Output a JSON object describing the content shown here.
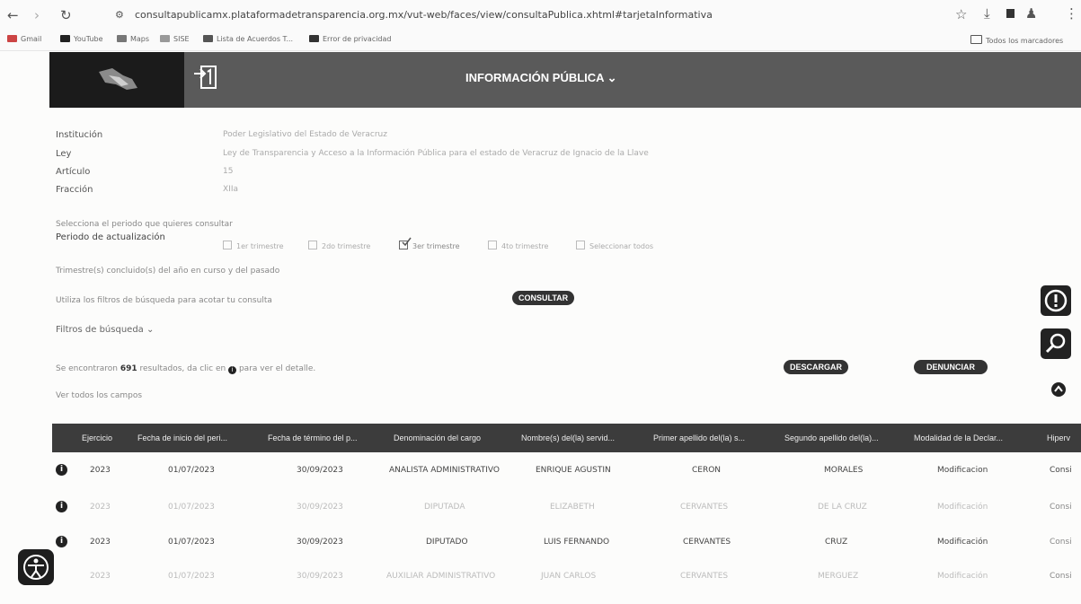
{
  "browser": {
    "url": "consultapublicamx.plataformadetransparencia.org.mx/vut-web/faces/view/consultaPublica.xhtml#tarjetaInformativa",
    "bookmarks": [
      "Gmail",
      "YouTube",
      "Maps",
      "SISE",
      "Lista de Acuerdos T...",
      "Error de privacidad"
    ],
    "all_bookmarks": "Todos los marcadores"
  },
  "header": {
    "title": "INFORMACIÓN PÚBLICA ⌄"
  },
  "info": {
    "institucion_label": "Institución",
    "institucion_value": "Poder Legislativo del Estado de Veracruz",
    "ley_label": "Ley",
    "ley_value": "Ley de Transparencia y Acceso a la Información Pública para el estado de Veracruz de Ignacio de la Llave",
    "articulo_label": "Artículo",
    "articulo_value": "15",
    "fraccion_label": "Fracción",
    "fraccion_value": "XIIa"
  },
  "periodo": {
    "prompt": "Selecciona el periodo que quieres consultar",
    "label": "Periodo de actualización",
    "quarters": [
      "1er trimestre",
      "2do trimestre",
      "3er trimestre",
      "4to trimestre",
      "Seleccionar todos"
    ]
  },
  "concluded_note": "Trimestre(s) concluido(s) del año en curso y del pasado",
  "filter_hint": "Utiliza los filtros de búsqueda para acotar tu consulta",
  "consultar_label": "CONSULTAR",
  "filtros_label": "Filtros de búsqueda ⌄",
  "results": {
    "prefix": "Se encontraron",
    "count": "691",
    "suffix": "resultados, da clic en",
    "suffix2": "para ver el detalle."
  },
  "descargar_label": "DESCARGAR",
  "denunciar_label": "DENUNCIAR",
  "ver_campos": "Ver todos los campos",
  "table": {
    "headers": [
      "Ejercicio",
      "Fecha de inicio del peri...",
      "Fecha de término del p...",
      "Denominación del cargo",
      "Nombre(s) del(la) servid...",
      "Primer apellido del(la) s...",
      "Segundo apellido del(la)...",
      "Modalidad de la Declar...",
      "Hiperv"
    ],
    "rows": [
      [
        "2023",
        "01/07/2023",
        "30/09/2023",
        "ANALISTA ADMINISTRATIVO",
        "ENRIQUE AGUSTIN",
        "CERON",
        "MORALES",
        "Modificacion",
        "Consi"
      ],
      [
        "2023",
        "01/07/2023",
        "30/09/2023",
        "DIPUTADA",
        "ELIZABETH",
        "CERVANTES",
        "DE LA CRUZ",
        "Modificación",
        "Consi"
      ],
      [
        "2023",
        "01/07/2023",
        "30/09/2023",
        "DIPUTADO",
        "LUIS FERNANDO",
        "CERVANTES",
        "CRUZ",
        "Modificación",
        "Consi"
      ],
      [
        "2023",
        "01/07/2023",
        "30/09/2023",
        "AUXILIAR ADMINISTRATIVO",
        "JUAN CARLOS",
        "CERVANTES",
        "MERGUEZ",
        "Modificación",
        "Consi"
      ]
    ]
  }
}
